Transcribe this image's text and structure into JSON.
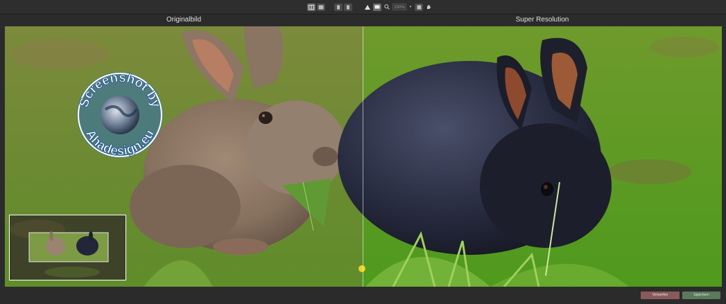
{
  "toolbar": {
    "zoom_value": "100%",
    "buttons": [
      "side-by-side-view",
      "split-view",
      "compare-left",
      "compare-right",
      "warning",
      "fit-screen",
      "zoom",
      "zoom-in",
      "hand-tool"
    ]
  },
  "headers": {
    "left": "Originalbild",
    "right": "Super Resolution"
  },
  "watermark": {
    "text_top": "Screenshot by",
    "text_bottom": "Ahadesign.eu"
  },
  "bottom": {
    "reset_label": "Verwerfen",
    "save_label": "Speichern"
  },
  "colors": {
    "reset_button": "#8a5a5a",
    "save_button": "#5b7a5b",
    "background": "#2b2b2b"
  }
}
